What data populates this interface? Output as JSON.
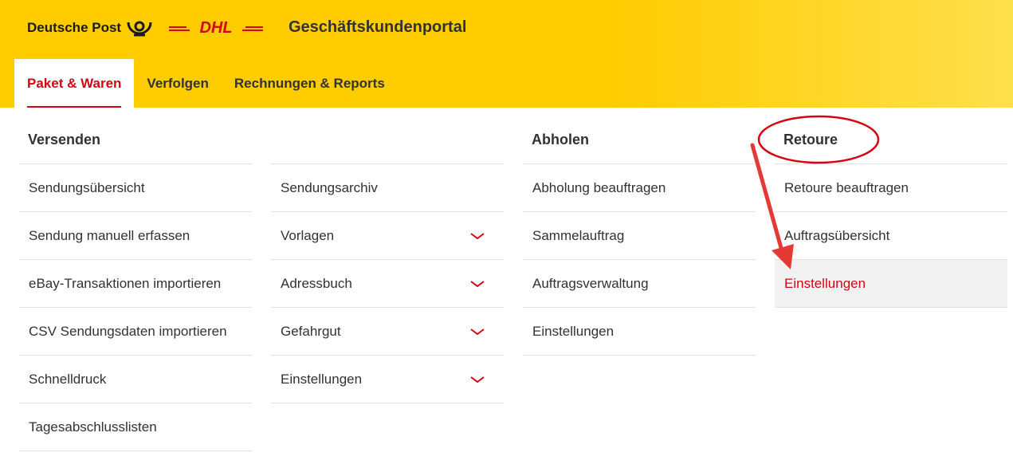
{
  "header": {
    "brand_dp": "Deutsche Post",
    "brand_dhl": "DHL",
    "portal_title": "Geschäftskundenportal",
    "bg_color": "#ffcc00",
    "accent_color": "#d40511"
  },
  "nav": {
    "tabs": [
      {
        "label": "Paket & Waren",
        "active": true
      },
      {
        "label": "Verfolgen",
        "active": false
      },
      {
        "label": "Rechnungen & Reports",
        "active": false
      }
    ]
  },
  "menu": {
    "versenden": {
      "heading": "Versenden",
      "items": [
        {
          "label": "Sendungsübersicht"
        },
        {
          "label": "Sendung manuell erfassen"
        },
        {
          "label": "eBay-Transaktionen importieren"
        },
        {
          "label": "CSV Sendungsdaten importieren"
        },
        {
          "label": "Schnelldruck"
        },
        {
          "label": "Tagesabschlusslisten"
        }
      ]
    },
    "versenden2": {
      "items": [
        {
          "label": "Sendungsarchiv",
          "icon": null
        },
        {
          "label": "Vorlagen",
          "icon": "chevron-down-icon"
        },
        {
          "label": "Adressbuch",
          "icon": "chevron-down-icon"
        },
        {
          "label": "Gefahrgut",
          "icon": "chevron-down-icon"
        },
        {
          "label": "Einstellungen",
          "icon": "chevron-down-icon"
        }
      ]
    },
    "abholen": {
      "heading": "Abholen",
      "items": [
        {
          "label": "Abholung beauftragen"
        },
        {
          "label": "Sammelauftrag"
        },
        {
          "label": "Auftragsverwaltung"
        },
        {
          "label": "Einstellungen"
        }
      ]
    },
    "retoure": {
      "heading": "Retoure",
      "items": [
        {
          "label": "Retoure beauftragen"
        },
        {
          "label": "Auftragsübersicht"
        },
        {
          "label": "Einstellungen",
          "selected": true
        }
      ]
    }
  },
  "annotation": {
    "circle_color": "#d40511",
    "arrow_color": "#e53935"
  }
}
